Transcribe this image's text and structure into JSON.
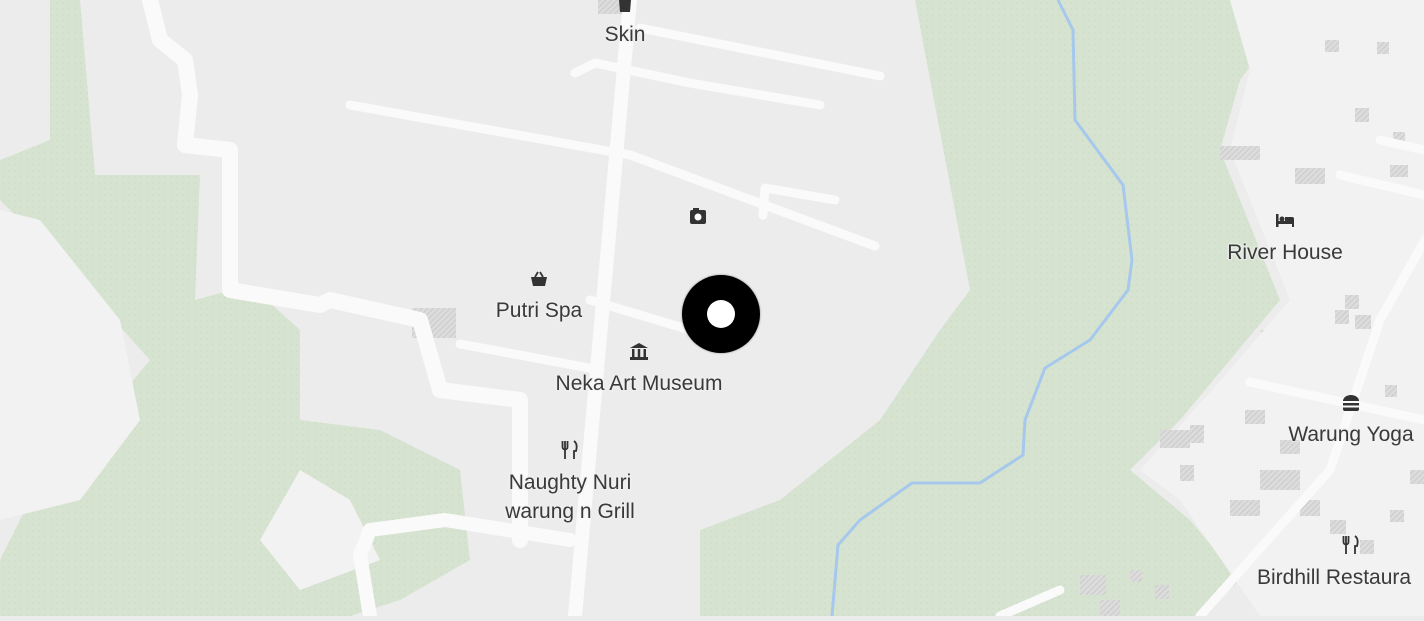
{
  "map": {
    "colors": {
      "background": "#ececec",
      "land": "#f0f0f0",
      "vegetation": "#d6e3d0",
      "road": "#fafafa",
      "river": "#a6c8ec",
      "building": "#d2d2d2",
      "marker": "#000000"
    },
    "pois": [
      {
        "id": "skin",
        "icon": "shopping-bag-icon",
        "label": "Skin"
      },
      {
        "id": "photo",
        "icon": "camera-icon",
        "label": ""
      },
      {
        "id": "putri-spa",
        "icon": "shopping-basket-icon",
        "label": "Putri Spa"
      },
      {
        "id": "neka-art-museum",
        "icon": "museum-icon",
        "label": "Neka Art Museum"
      },
      {
        "id": "naughty-nuri",
        "icon": "restaurant-icon",
        "label_line1": "Naughty Nuri",
        "label_line2": "warung n Grill"
      },
      {
        "id": "river-house",
        "icon": "hotel-bed-icon",
        "label": "River House"
      },
      {
        "id": "warung-yoga",
        "icon": "burger-icon",
        "label": "Warung Yoga"
      },
      {
        "id": "birdhill",
        "icon": "restaurant-icon",
        "label": "Birdhill Restaura"
      }
    ],
    "marker": {
      "name": "current-location-marker"
    }
  }
}
